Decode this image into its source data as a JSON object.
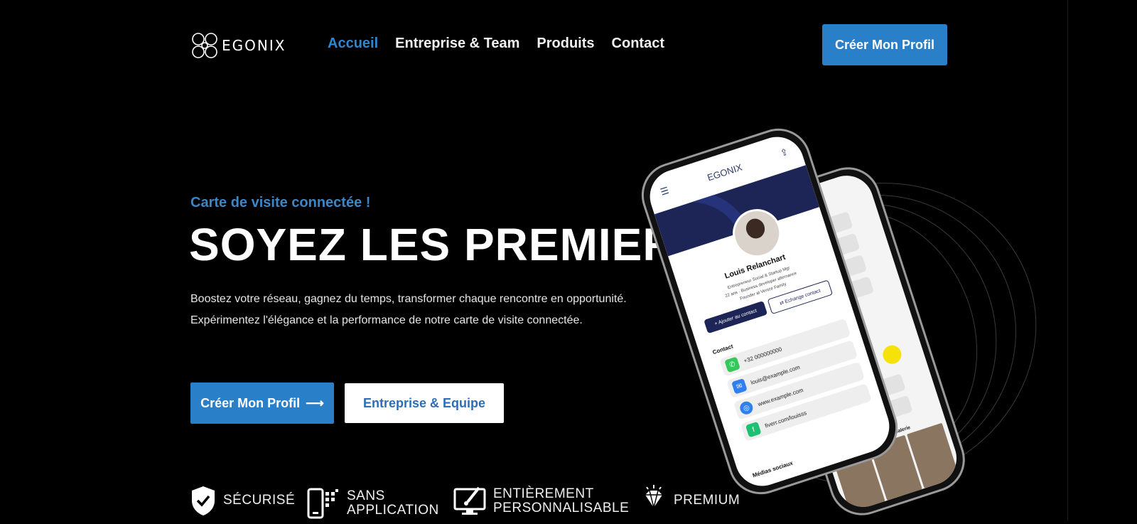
{
  "brand": {
    "name": "EGONIX"
  },
  "nav": {
    "items": [
      {
        "label": "Accueil",
        "active": true
      },
      {
        "label": "Entreprise & Team",
        "active": false
      },
      {
        "label": "Produits",
        "active": false
      },
      {
        "label": "Contact",
        "active": false
      }
    ],
    "cta_label": "Créer Mon Profil"
  },
  "hero": {
    "eyebrow": "Carte de visite connectée !",
    "title": "SOYEZ LES PREMIERS",
    "description_line1": "Boostez votre réseau, gagnez du temps, transformer chaque rencontre en opportunité.",
    "description_line2": "Expérimentez l'élégance et la performance de notre carte de visite connectée.",
    "primary_button": "Créer Mon Profil",
    "primary_arrow": "⟶",
    "secondary_button": "Entreprise & Equipe"
  },
  "features": [
    {
      "icon": "shield-check-icon",
      "label": "SÉCURISÉ"
    },
    {
      "icon": "phone-no-app-icon",
      "label": "SANS\nAPPLICATION"
    },
    {
      "icon": "monitor-brush-icon",
      "label": "ENTIÈREMENT\nPERSONNALISABLE"
    },
    {
      "icon": "diamond-icon",
      "label": "PREMIUM"
    }
  ],
  "phone": {
    "brand": "EGONIX",
    "name": "Louis Relanchart",
    "subtitle": "Entrepreneur Social & Startup Mgr\n22 ans · Business developer alternance\nFounder at Venice Family",
    "add_contact": "+ Ajouter au contact",
    "exchange_contact": "⇄ Echange contact",
    "contact_label": "Contact",
    "contacts": [
      {
        "icon": "phone-icon",
        "value": "+32 000000000",
        "color": "#34c759"
      },
      {
        "icon": "mail-icon",
        "value": "louis@example.com",
        "color": "#2f7ff0"
      },
      {
        "icon": "safari-icon",
        "value": "www.example.com",
        "color": "#2f7ff0"
      },
      {
        "icon": "fiverr-icon",
        "value": "fiverr.com/louisss",
        "color": "#1dbf73"
      }
    ],
    "medias_label": "Médias sociaux",
    "gallery_label": "Galerie"
  },
  "colors": {
    "accent": "#2a7fc9",
    "background": "#000000",
    "eyebrow": "#3d86c6"
  }
}
